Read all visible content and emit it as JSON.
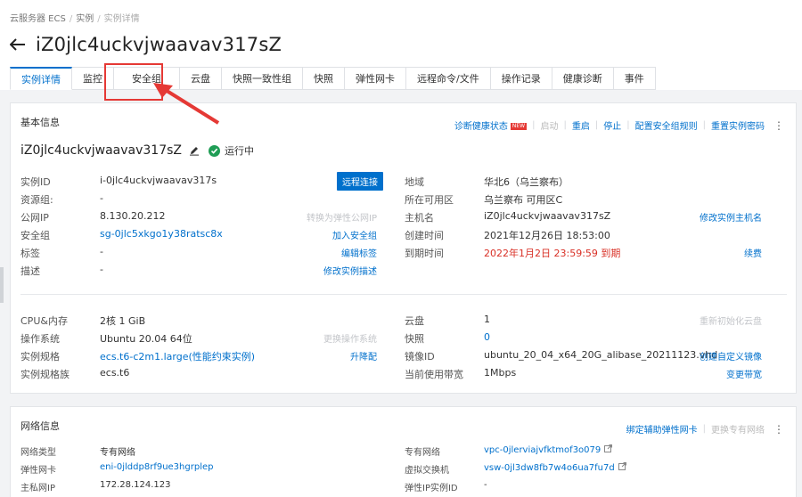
{
  "breadcrumb": [
    "云服务器 ECS",
    "实例",
    "实例详情"
  ],
  "page_title": "iZ0jlc4uckvjwaavav317sZ",
  "tabs": [
    "实例详情",
    "监控",
    "安全组",
    "云盘",
    "快照一致性组",
    "快照",
    "弹性网卡",
    "远程命令/文件",
    "操作记录",
    "健康诊断",
    "事件"
  ],
  "basic": {
    "title": "基本信息",
    "actions": {
      "diagnose": "诊断健康状态",
      "new_badge": "NEW",
      "start": "启动",
      "restart": "重启",
      "stop": "停止",
      "config_sg": "配置安全组规则",
      "reset_pwd": "重置实例密码",
      "more": "⋮"
    },
    "instance_name": "iZ0jlc4uckvjwaavav317sZ",
    "status": "运行中",
    "left": [
      {
        "label": "实例ID",
        "value": "i-0jlc4uckvjwaavav317s",
        "op": "远程连接"
      },
      {
        "label": "资源组:",
        "value": "-",
        "op": ""
      },
      {
        "label": "公网IP",
        "value": "8.130.20.212",
        "op": "转换为弹性公网IP"
      },
      {
        "label": "安全组",
        "value": "sg-0jlc5xkgo1y38ratsc8x",
        "op": "加入安全组"
      },
      {
        "label": "标签",
        "value": "-",
        "op": "编辑标签"
      },
      {
        "label": "描述",
        "value": "-",
        "op": "修改实例描述"
      }
    ],
    "right": [
      {
        "label": "地域",
        "value": "华北6（乌兰察布）",
        "op": ""
      },
      {
        "label": "所在可用区",
        "value": "乌兰察布 可用区C",
        "op": ""
      },
      {
        "label": "主机名",
        "value": "iZ0jlc4uckvjwaavav317sZ",
        "op": "修改实例主机名"
      },
      {
        "label": "创建时间",
        "value": "2021年12月26日 18:53:00",
        "op": ""
      },
      {
        "label": "到期时间",
        "value": "2022年1月2日 23:59:59 到期",
        "op": "续费"
      }
    ],
    "left2": [
      {
        "label": "CPU&内存",
        "value": "2核 1 GiB",
        "op": ""
      },
      {
        "label": "操作系统",
        "value": "Ubuntu 20.04 64位",
        "op": "更换操作系统"
      },
      {
        "label": "实例规格",
        "value": "ecs.t6-c2m1.large(性能约束实例)",
        "op": "升降配"
      },
      {
        "label": "实例规格族",
        "value": "ecs.t6",
        "op": ""
      }
    ],
    "right2": [
      {
        "label": "云盘",
        "value": "1",
        "op": "重新初始化云盘"
      },
      {
        "label": "快照",
        "value": "0",
        "op": ""
      },
      {
        "label": "镜像ID",
        "value": "ubuntu_20_04_x64_20G_alibase_20211123.vhd",
        "op": "创建自定义镜像"
      },
      {
        "label": "当前使用带宽",
        "value": "1Mbps",
        "op": "变更带宽"
      }
    ]
  },
  "network": {
    "title": "网络信息",
    "actions": {
      "bind_eni": "绑定辅助弹性网卡",
      "change_vpc": "更换专有网络",
      "more": "⋮"
    },
    "left": [
      {
        "label": "网络类型",
        "value": "专有网络"
      },
      {
        "label": "弹性网卡",
        "value": "eni-0jlddp8rf9ue3hgrplep"
      },
      {
        "label": "主私网IP",
        "value": "172.28.124.123"
      }
    ],
    "right": [
      {
        "label": "专有网络",
        "value": "vpc-0jlerviajvfktmof3o079"
      },
      {
        "label": "虚拟交换机",
        "value": "vsw-0jl3dw8fb7w4o6ua7fu7d"
      },
      {
        "label": "弹性IP实例ID",
        "value": "-"
      }
    ]
  },
  "colors": {
    "accent": "#0070cc",
    "status_ok": "#1f9d55",
    "danger": "#d93026",
    "highlight": "#e53935"
  }
}
